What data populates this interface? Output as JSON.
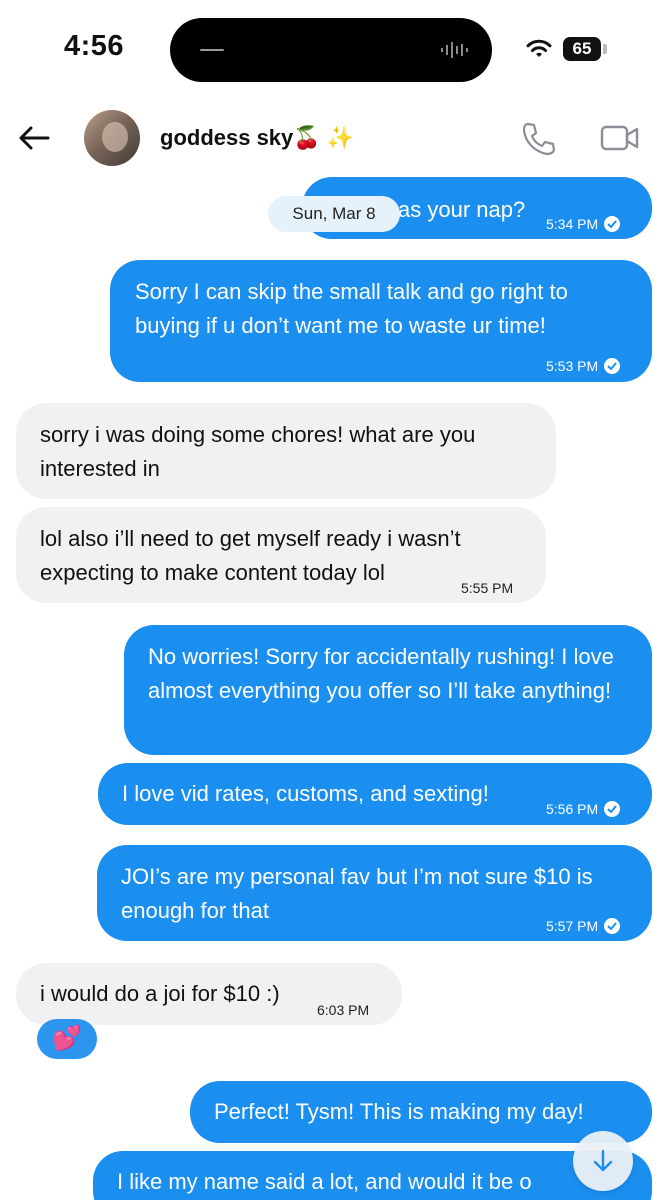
{
  "status_bar": {
    "time": "4:56",
    "battery": "65"
  },
  "header": {
    "contact_name": "goddess sky🍒 ✨",
    "back_icon": "arrow-left-icon",
    "call_icon": "phone-icon",
    "video_icon": "video-camera-icon"
  },
  "date_separator": "Sun, Mar 8",
  "messages": [
    {
      "dir": "out",
      "text": "as your nap?",
      "time": "5:34 PM",
      "read": true
    },
    {
      "dir": "out",
      "text": "Sorry I can skip the small talk and go right to buying if u don’t want me to waste ur time!",
      "time": "5:53 PM",
      "read": true
    },
    {
      "dir": "in",
      "text": "sorry i was doing some chores! what are you interested in",
      "time": ""
    },
    {
      "dir": "in",
      "text": "lol also i’ll need to get myself ready i wasn’t expecting to make content today lol",
      "time": "5:55 PM"
    },
    {
      "dir": "out",
      "text": "No worries! Sorry for accidentally rushing! I love almost everything you offer so I’ll take anything!",
      "time": ""
    },
    {
      "dir": "out",
      "text": "I love vid rates, customs, and sexting!",
      "time": "5:56 PM",
      "read": true
    },
    {
      "dir": "out",
      "text": "JOI’s are my personal fav but I’m not sure $10 is enough for that",
      "time": "5:57 PM",
      "read": true
    },
    {
      "dir": "in",
      "text": "i would do a joi for $10 :)",
      "time": "6:03 PM"
    },
    {
      "dir": "out",
      "text": "Perfect! Tysm! This is making my day!",
      "time": ""
    },
    {
      "dir": "out",
      "text": "I like my name said a lot, and would it be o",
      "time": ""
    }
  ],
  "reaction": {
    "emoji": "💕"
  },
  "scroll_button_icon": "arrow-down-icon",
  "colors": {
    "outgoing_bubble": "#1b8ff0",
    "incoming_bubble": "#eff1f3",
    "accent": "#1b8ff0"
  }
}
